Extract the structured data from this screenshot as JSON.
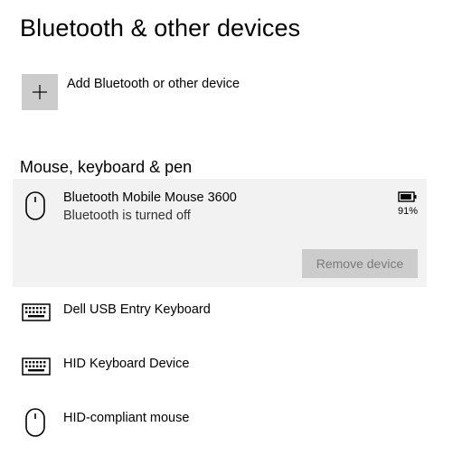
{
  "page": {
    "title": "Bluetooth & other devices"
  },
  "add_device": {
    "label": "Add Bluetooth or other device",
    "icon": "plus-icon"
  },
  "section": {
    "title": "Mouse, keyboard & pen"
  },
  "devices": [
    {
      "name": "Bluetooth Mobile Mouse 3600",
      "status": "Bluetooth is turned off",
      "icon": "mouse-icon",
      "battery": "91%",
      "battery_level": 0.91,
      "selected": true,
      "action_label": "Remove device"
    },
    {
      "name": "Dell USB Entry Keyboard",
      "icon": "keyboard-icon"
    },
    {
      "name": "HID Keyboard Device",
      "icon": "keyboard-icon"
    },
    {
      "name": "HID-compliant mouse",
      "icon": "mouse-icon"
    }
  ],
  "colors": {
    "selected_background": "#f2f2f2",
    "tile_background": "#cccccc",
    "disabled_text": "#7a7a7a"
  }
}
